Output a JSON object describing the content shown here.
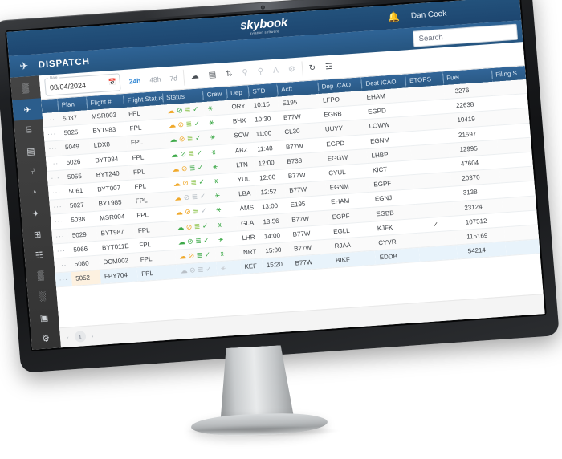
{
  "brand": {
    "name": "skybook",
    "subtitle": "aviation software"
  },
  "topbar": {
    "bell_icon": "bell-icon",
    "user": "Dan Cook"
  },
  "appbar": {
    "plane_icon": "plane-icon",
    "title": "DISPATCH"
  },
  "search": {
    "placeholder": "Search",
    "value": ""
  },
  "toolbar": {
    "date_label": "Date",
    "date_value": "08/04/2024",
    "calendar_icon": "calendar-icon",
    "ranges": [
      {
        "label": "24h",
        "active": true
      },
      {
        "label": "48h",
        "active": false
      },
      {
        "label": "7d",
        "active": false
      }
    ],
    "icons": [
      {
        "name": "cloud-upload-icon",
        "glyph": "☁",
        "dim": false
      },
      {
        "name": "document-icon",
        "glyph": "▤",
        "dim": false
      },
      {
        "name": "sort-updown-icon",
        "glyph": "⇅",
        "dim": false
      },
      {
        "name": "zoom-out-icon",
        "glyph": "⚲",
        "dim": true
      },
      {
        "name": "zoom-in-icon",
        "glyph": "⚲",
        "dim": true
      },
      {
        "name": "filter-icon",
        "glyph": "ᐱ",
        "dim": true
      },
      {
        "name": "settings-gear-icon",
        "glyph": "⚙",
        "dim": true
      }
    ],
    "icons_right": [
      {
        "name": "refresh-icon",
        "glyph": "↻",
        "dim": false
      },
      {
        "name": "column-options-icon",
        "glyph": "☲",
        "dim": false
      }
    ]
  },
  "sidebar": {
    "items": [
      {
        "name": "sidebar-item-grid",
        "glyph": "▒",
        "selected": false
      },
      {
        "name": "sidebar-item-dispatch",
        "glyph": "✈",
        "selected": true
      },
      {
        "name": "sidebar-item-briefing",
        "glyph": "⌸",
        "selected": false
      },
      {
        "name": "sidebar-item-documents",
        "glyph": "▤",
        "selected": false
      },
      {
        "name": "sidebar-item-routes",
        "glyph": "⑂",
        "selected": false
      },
      {
        "name": "sidebar-item-weather",
        "glyph": "◔",
        "selected": false
      },
      {
        "name": "sidebar-item-flights",
        "glyph": "✦",
        "selected": false
      },
      {
        "name": "sidebar-item-tracking",
        "glyph": "⊞",
        "selected": false
      },
      {
        "name": "sidebar-item-reports",
        "glyph": "☷",
        "selected": false
      },
      {
        "name": "sidebar-item-analytics",
        "glyph": "▒",
        "selected": false
      },
      {
        "name": "sidebar-item-schedule",
        "glyph": "░",
        "selected": false
      },
      {
        "name": "sidebar-item-devices",
        "glyph": "▣",
        "selected": false
      },
      {
        "name": "sidebar-item-admin",
        "glyph": "⚙",
        "selected": false
      }
    ]
  },
  "table": {
    "columns": [
      "",
      "Plan",
      "Flight #",
      "Flight Status",
      "Status",
      "Crew",
      "Dep",
      "STD",
      "Acft",
      "Dep ICAO",
      "Dest ICAO",
      "ETOPS",
      "Fuel",
      "Filing S"
    ],
    "rows": [
      {
        "dots": "···",
        "plan": "5037",
        "flight": "MSR003",
        "flight_status": "FPL",
        "status": [
          "o",
          "g",
          "lg",
          "g"
        ],
        "crew": true,
        "dep": "ORY",
        "std": "10:15",
        "acft": "E195",
        "dep_icao": "LFPO",
        "dest_icao": "EHAM",
        "etops": "",
        "fuel": "3276",
        "highlight": false
      },
      {
        "dots": "···",
        "plan": "5025",
        "flight": "BYT983",
        "flight_status": "FPL",
        "status": [
          "o",
          "o",
          "lg",
          "g"
        ],
        "crew": true,
        "dep": "BHX",
        "std": "10:30",
        "acft": "B77W",
        "dep_icao": "EGBB",
        "dest_icao": "EGPD",
        "etops": "",
        "fuel": "22638",
        "highlight": false
      },
      {
        "dots": "···",
        "plan": "5049",
        "flight": "LDX8",
        "flight_status": "FPL",
        "status": [
          "g",
          "o",
          "lg",
          "g"
        ],
        "crew": true,
        "dep": "SCW",
        "std": "11:00",
        "acft": "CL30",
        "dep_icao": "UUYY",
        "dest_icao": "LOWW",
        "etops": "",
        "fuel": "10419",
        "highlight": false
      },
      {
        "dots": "···",
        "plan": "5026",
        "flight": "BYT984",
        "flight_status": "FPL",
        "status": [
          "g",
          "g",
          "lg",
          "g"
        ],
        "crew": true,
        "dep": "ABZ",
        "std": "11:48",
        "acft": "B77W",
        "dep_icao": "EGPD",
        "dest_icao": "EGNM",
        "etops": "",
        "fuel": "21597",
        "highlight": false
      },
      {
        "dots": "···",
        "plan": "5055",
        "flight": "BYT240",
        "flight_status": "FPL",
        "status": [
          "o",
          "o",
          "g",
          "g"
        ],
        "crew": true,
        "dep": "LTN",
        "std": "12:00",
        "acft": "B738",
        "dep_icao": "EGGW",
        "dest_icao": "LHBP",
        "etops": "",
        "fuel": "12995",
        "highlight": false
      },
      {
        "dots": "···",
        "plan": "5061",
        "flight": "BYT007",
        "flight_status": "FPL",
        "status": [
          "o",
          "o",
          "lg",
          "g"
        ],
        "crew": true,
        "dep": "YUL",
        "std": "12:00",
        "acft": "B77W",
        "dep_icao": "CYUL",
        "dest_icao": "KICT",
        "etops": "",
        "fuel": "47604",
        "highlight": false
      },
      {
        "dots": "···",
        "plan": "5027",
        "flight": "BYT985",
        "flight_status": "FPL",
        "status": [
          "o",
          "gy",
          "gy",
          "gy"
        ],
        "crew": true,
        "dep": "LBA",
        "std": "12:52",
        "acft": "B77W",
        "dep_icao": "EGNM",
        "dest_icao": "EGPF",
        "etops": "",
        "fuel": "20370",
        "highlight": false
      },
      {
        "dots": "···",
        "plan": "5038",
        "flight": "MSR004",
        "flight_status": "FPL",
        "status": [
          "o",
          "o",
          "lg",
          "gy"
        ],
        "crew": true,
        "dep": "AMS",
        "std": "13:00",
        "acft": "E195",
        "dep_icao": "EHAM",
        "dest_icao": "EGNJ",
        "etops": "",
        "fuel": "3138",
        "highlight": false
      },
      {
        "dots": "···",
        "plan": "5029",
        "flight": "BYT987",
        "flight_status": "FPL",
        "status": [
          "g",
          "o",
          "lg",
          "g"
        ],
        "crew": true,
        "dep": "GLA",
        "std": "13:56",
        "acft": "B77W",
        "dep_icao": "EGPF",
        "dest_icao": "EGBB",
        "etops": "",
        "fuel": "23124",
        "highlight": false
      },
      {
        "dots": "···",
        "plan": "5066",
        "flight": "BYT011E",
        "flight_status": "FPL",
        "status": [
          "g",
          "g",
          "g",
          "g"
        ],
        "crew": true,
        "dep": "LHR",
        "std": "14:00",
        "acft": "B77W",
        "dep_icao": "EGLL",
        "dest_icao": "KJFK",
        "etops": "✓",
        "fuel": "107512",
        "highlight": false
      },
      {
        "dots": "···",
        "plan": "5080",
        "flight": "DCM002",
        "flight_status": "FPL",
        "status": [
          "o",
          "o",
          "g",
          "g"
        ],
        "crew": true,
        "dep": "NRT",
        "std": "15:00",
        "acft": "B77W",
        "dep_icao": "RJAA",
        "dest_icao": "CYVR",
        "etops": "",
        "fuel": "115169",
        "highlight": false
      },
      {
        "dots": "···",
        "plan": "5052",
        "flight": "FPY704",
        "flight_status": "FPL",
        "status": [
          "gy",
          "gy",
          "gy",
          "gy"
        ],
        "crew": false,
        "dep": "KEF",
        "std": "15:20",
        "acft": "B77W",
        "dep_icao": "BIKF",
        "dest_icao": "EDDB",
        "etops": "",
        "fuel": "54214",
        "highlight": true
      }
    ]
  },
  "pager": {
    "prev": "‹",
    "page": "1",
    "next": "›"
  },
  "colors": {
    "brand_blue": "#2b5d8c",
    "dark_blue": "#1d4670",
    "accent": "#2f86d4",
    "green": "#3faa4a",
    "orange": "#f0a92b",
    "highlight_row": "#e8f3fb"
  }
}
